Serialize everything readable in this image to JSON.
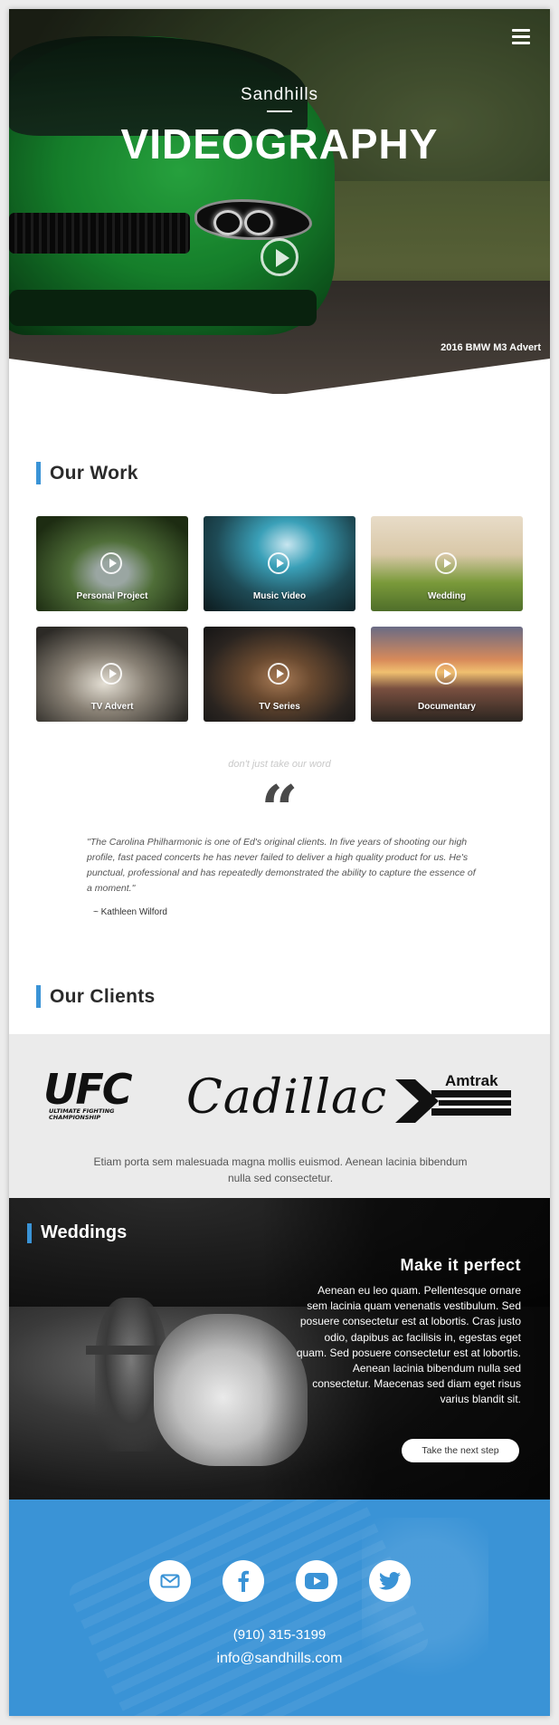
{
  "hero": {
    "kicker": "Sandhills",
    "title": "VIDEOGRAPHY",
    "caption": "2016 BMW M3 Advert",
    "menu_icon": "hamburger-menu-icon",
    "play_icon": "play-circle-icon"
  },
  "our_work": {
    "heading": "Our Work",
    "items": [
      {
        "label": "Personal Project"
      },
      {
        "label": "Music Video"
      },
      {
        "label": "Wedding"
      },
      {
        "label": "TV Advert"
      },
      {
        "label": "TV Series"
      },
      {
        "label": "Documentary"
      }
    ]
  },
  "testimonial": {
    "kicker": "don't just take our word",
    "quote_mark": "“",
    "text": "\"The Carolina Philharmonic is one of Ed's original clients. In five years of shooting our high profile, fast paced concerts he has never failed to deliver a high quality product for us. He's punctual, professional and has repeatedly demonstrated the ability to capture the essence of a moment.\"",
    "author": "~ Kathleen Wilford"
  },
  "clients": {
    "heading": "Our Clients",
    "logos": [
      {
        "name": "UFC",
        "big": "UFC",
        "sub_lines": [
          "ULTIMATE FIGHTING",
          "CHAMPIONSHIP"
        ]
      },
      {
        "name": "Cadillac",
        "text": "Cadillac"
      },
      {
        "name": "Amtrak",
        "text": "Amtrak"
      }
    ],
    "text": "Etiam porta sem malesuada magna mollis euismod. Aenean lacinia bibendum nulla sed consectetur."
  },
  "weddings": {
    "heading": "Weddings",
    "title": "Make it perfect",
    "body": "Aenean eu leo quam. Pellentesque ornare sem lacinia quam venenatis vestibulum. Sed posuere consectetur est at lobortis. Cras justo odio, dapibus ac facilisis in, egestas eget quam. Sed posuere consectetur est at lobortis. Aenean lacinia bibendum nulla sed consectetur. Maecenas sed diam eget risus varius blandit sit.",
    "button": "Take the next step"
  },
  "contact": {
    "social": [
      {
        "name": "email-icon"
      },
      {
        "name": "facebook-icon"
      },
      {
        "name": "youtube-icon"
      },
      {
        "name": "twitter-icon"
      }
    ],
    "phone": "(910) 315-3199",
    "email": "info@sandhills.com"
  },
  "colors": {
    "accent": "#3a93d6",
    "clients_band": "#ebebeb",
    "contact_bg": "#3a93d6",
    "dark_text": "#2b2b2b"
  }
}
